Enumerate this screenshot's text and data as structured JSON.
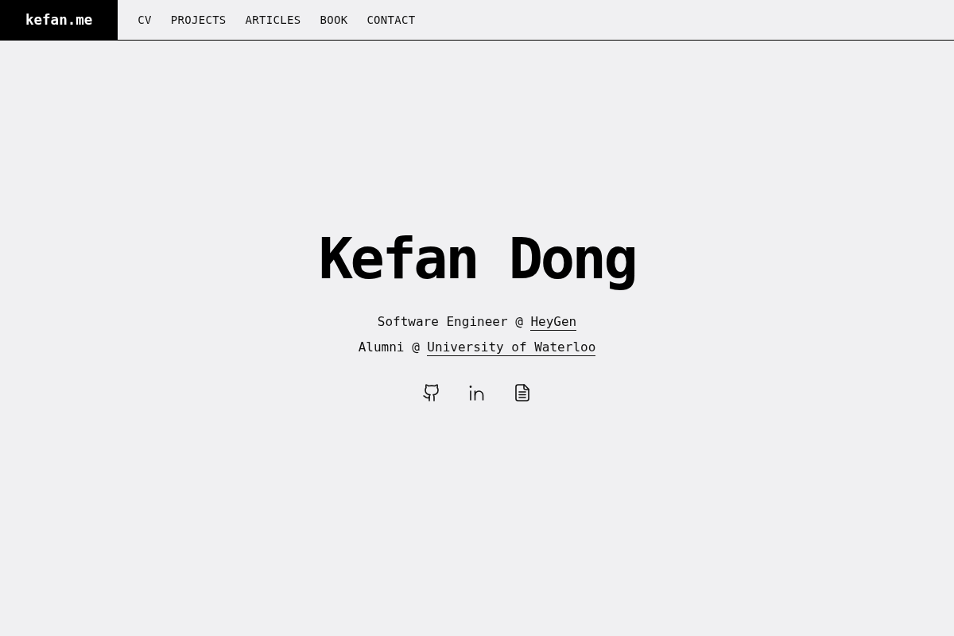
{
  "header": {
    "logo": "kefan.me",
    "nav": [
      {
        "label": "CV"
      },
      {
        "label": "PROJECTS"
      },
      {
        "label": "ARTICLES"
      },
      {
        "label": "BOOK"
      },
      {
        "label": "CONTACT"
      }
    ]
  },
  "hero": {
    "name": "Kefan Dong",
    "lines": [
      {
        "text": "Software Engineer @",
        "link": "HeyGen"
      },
      {
        "text": "Alumni @",
        "link": "University of Waterloo"
      }
    ],
    "social_links": [
      {
        "kind": "github"
      },
      {
        "kind": "linkedin"
      },
      {
        "kind": "document"
      }
    ]
  }
}
